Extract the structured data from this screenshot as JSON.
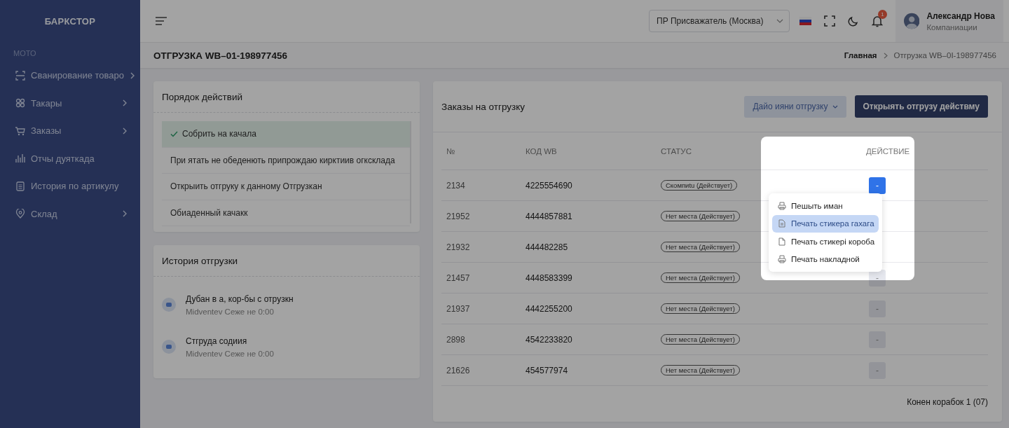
{
  "sidebar": {
    "logo": "БАРКСТОР",
    "section": "МОТО",
    "items": [
      {
        "label": "Сванирование товаро",
        "expandable": true
      },
      {
        "label": "Такары",
        "expandable": true
      },
      {
        "label": "Заказы",
        "expandable": true
      },
      {
        "label": "Отчы дуяткада",
        "expandable": false
      },
      {
        "label": "История по артикулу",
        "expandable": false
      },
      {
        "label": "Склад",
        "expandable": true
      }
    ]
  },
  "topbar": {
    "warehouse_select": {
      "value": "ПР Присважатель (Москва)"
    },
    "notifications": {
      "count": "1"
    },
    "user": {
      "name": "Александр Нова",
      "role": "Компаниации"
    }
  },
  "page_header": {
    "title": "ОТГРУЗКА WB–01-198977456",
    "breadcrumb": [
      "Главная",
      "Отгрузка WB–0I-198977456"
    ]
  },
  "steps": {
    "title": "Порядок действий",
    "items": [
      {
        "label": "Собрить на качала",
        "done": true
      },
      {
        "label": "При ятать не обеденють припрождаю кирктиив огксклада",
        "done": false
      },
      {
        "label": "Открыить отгруку к данному Отгрузкан",
        "done": false
      },
      {
        "label": "Обиаденный качакк",
        "done": false
      }
    ]
  },
  "history": {
    "title": "История отгрузки",
    "events": [
      {
        "title": "Дубан в а, кор-бы с отрузкн",
        "meta": "Midventev Сеже не 0:00"
      },
      {
        "title": "Стгруда содиия",
        "meta": "Midventev Сеже не 0:00"
      }
    ]
  },
  "orders": {
    "title": "Заказы на отгрузку",
    "filter_button": "Дайо ияни отгрузку",
    "primary_button": "Открыять отгрузу действму",
    "columns": [
      "№",
      "КОД WB",
      "СТАТУС",
      "ДЕЙСТВИЕ"
    ],
    "rows": [
      {
        "number": "2134",
        "code": "4225554690",
        "status": "Скомпиtu (Действует)",
        "action": "-",
        "active": true
      },
      {
        "number": "21952",
        "code": "4444857881",
        "status": "Нет места (Действует)"
      },
      {
        "number": "21932",
        "code": "444482285",
        "status": "Нет места (Действует)"
      },
      {
        "number": "21457",
        "code": "4448583399",
        "status": "Нет места (Действует)",
        "action": "-",
        "active": false
      },
      {
        "number": "21937",
        "code": "4442255200",
        "status": "Нет места (Действует)",
        "action": "-",
        "active": false
      },
      {
        "number": "2898",
        "code": "4542233820",
        "status": "Нет места (Действует)",
        "action": "-",
        "active": false
      },
      {
        "number": "21626",
        "code": "454577974",
        "status": "Нет места (Действует)",
        "action": "-",
        "active": false
      }
    ],
    "menu": [
      {
        "label": "Пешыть иман",
        "selected": false
      },
      {
        "label": "Печать стикера гахага",
        "selected": true
      },
      {
        "label": "Печать стикері короба",
        "selected": false
      },
      {
        "label": "Печать накладной",
        "selected": false
      }
    ],
    "footer": "Конен корабок 1 (07)"
  }
}
